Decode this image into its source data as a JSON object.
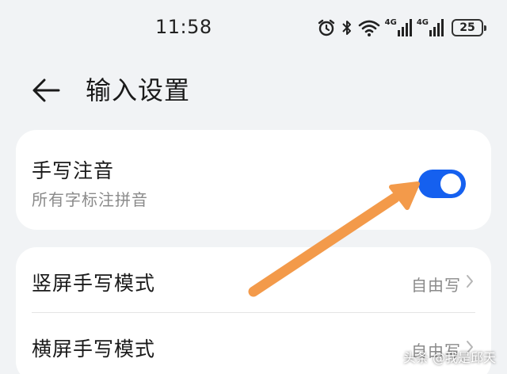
{
  "status_bar": {
    "time": "11:58",
    "network_1": "4G",
    "network_2": "4G",
    "battery": "25",
    "icons": [
      "alarm-icon",
      "bluetooth-icon",
      "wifi-icon",
      "signal-icon",
      "battery-icon"
    ]
  },
  "header": {
    "title": "输入设置",
    "back_icon": "back-arrow-icon"
  },
  "handwriting_pinyin": {
    "title": "手写注音",
    "subtitle": "所有字标注拼音",
    "enabled": true
  },
  "settings": [
    {
      "label": "竖屏手写模式",
      "value": "自由写"
    },
    {
      "label": "横屏手写模式",
      "value": "自由写"
    }
  ],
  "watermark": "头条 @我是邱天",
  "colors": {
    "toggle_on": "#1560ef",
    "annotation_arrow": "#f39a4a",
    "background": "#f1f3f5"
  }
}
